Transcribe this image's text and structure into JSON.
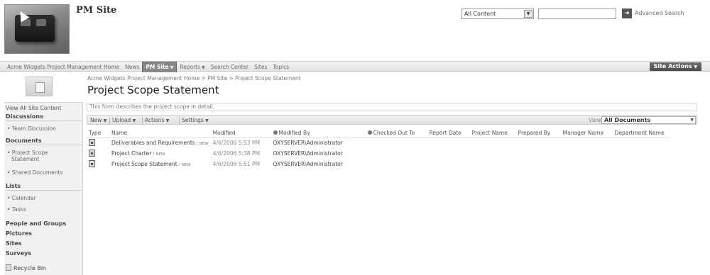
{
  "header": {
    "site_title": "PM Site",
    "search_scope": "All Content",
    "search_placeholder": "",
    "advanced_search": "Advanced Search"
  },
  "topnav": {
    "items": [
      {
        "label": "Acme Widgets Project Management Home",
        "active": false,
        "dropdown": false
      },
      {
        "label": "News",
        "active": false,
        "dropdown": false
      },
      {
        "label": "PM Site",
        "active": true,
        "dropdown": true
      },
      {
        "label": "Reports",
        "active": false,
        "dropdown": true
      },
      {
        "label": "Search Center",
        "active": false,
        "dropdown": false
      },
      {
        "label": "Sites",
        "active": false,
        "dropdown": false
      },
      {
        "label": "Topics",
        "active": false,
        "dropdown": false
      }
    ],
    "site_actions": "Site Actions"
  },
  "titlearea": {
    "breadcrumb": "Acme Widgets Project Management Home > PM Site > Project Scope Statement",
    "page_title": "Project Scope Statement"
  },
  "leftnav": {
    "view_all": "View All Site Content",
    "discussions": "Discussions",
    "team_discussion": "• Team Discussion",
    "documents": "Documents",
    "project_scope_1": "• Project Scope",
    "project_scope_2": "Statement",
    "shared_documents": "• Shared Documents",
    "lists": "Lists",
    "calendar": "• Calendar",
    "tasks": "• Tasks",
    "people_groups": "People and Groups",
    "pictures": "Pictures",
    "sites": "Sites",
    "surveys": "Surveys",
    "recycle_bin": "Recycle Bin"
  },
  "main": {
    "description": "This form describes the project scope in detail.",
    "toolbar": {
      "new": "New",
      "upload": "Upload",
      "actions": "Actions",
      "settings": "Settings",
      "view_label": "View:",
      "view_value": "All Documents"
    },
    "columns": [
      "Type",
      "Name",
      "Modified",
      "Modified By",
      "Checked Out To",
      "Report Date",
      "Project Name",
      "Prepared By",
      "Manager Name",
      "Department Name"
    ],
    "rows": [
      {
        "name": "Deliverables and Requirements",
        "new": "! NEW",
        "modified": "4/6/2006 5:53 PM",
        "modified_by": "OXYSERVER\\Administrator"
      },
      {
        "name": "Project Charter",
        "new": "! NEW",
        "modified": "4/6/2006 5:38 PM",
        "modified_by": "OXYSERVER\\Administrator"
      },
      {
        "name": "Project Scope Statement",
        "new": "! NEW",
        "modified": "4/6/2006 5:51 PM",
        "modified_by": "OXYSERVER\\Administrator"
      }
    ]
  }
}
